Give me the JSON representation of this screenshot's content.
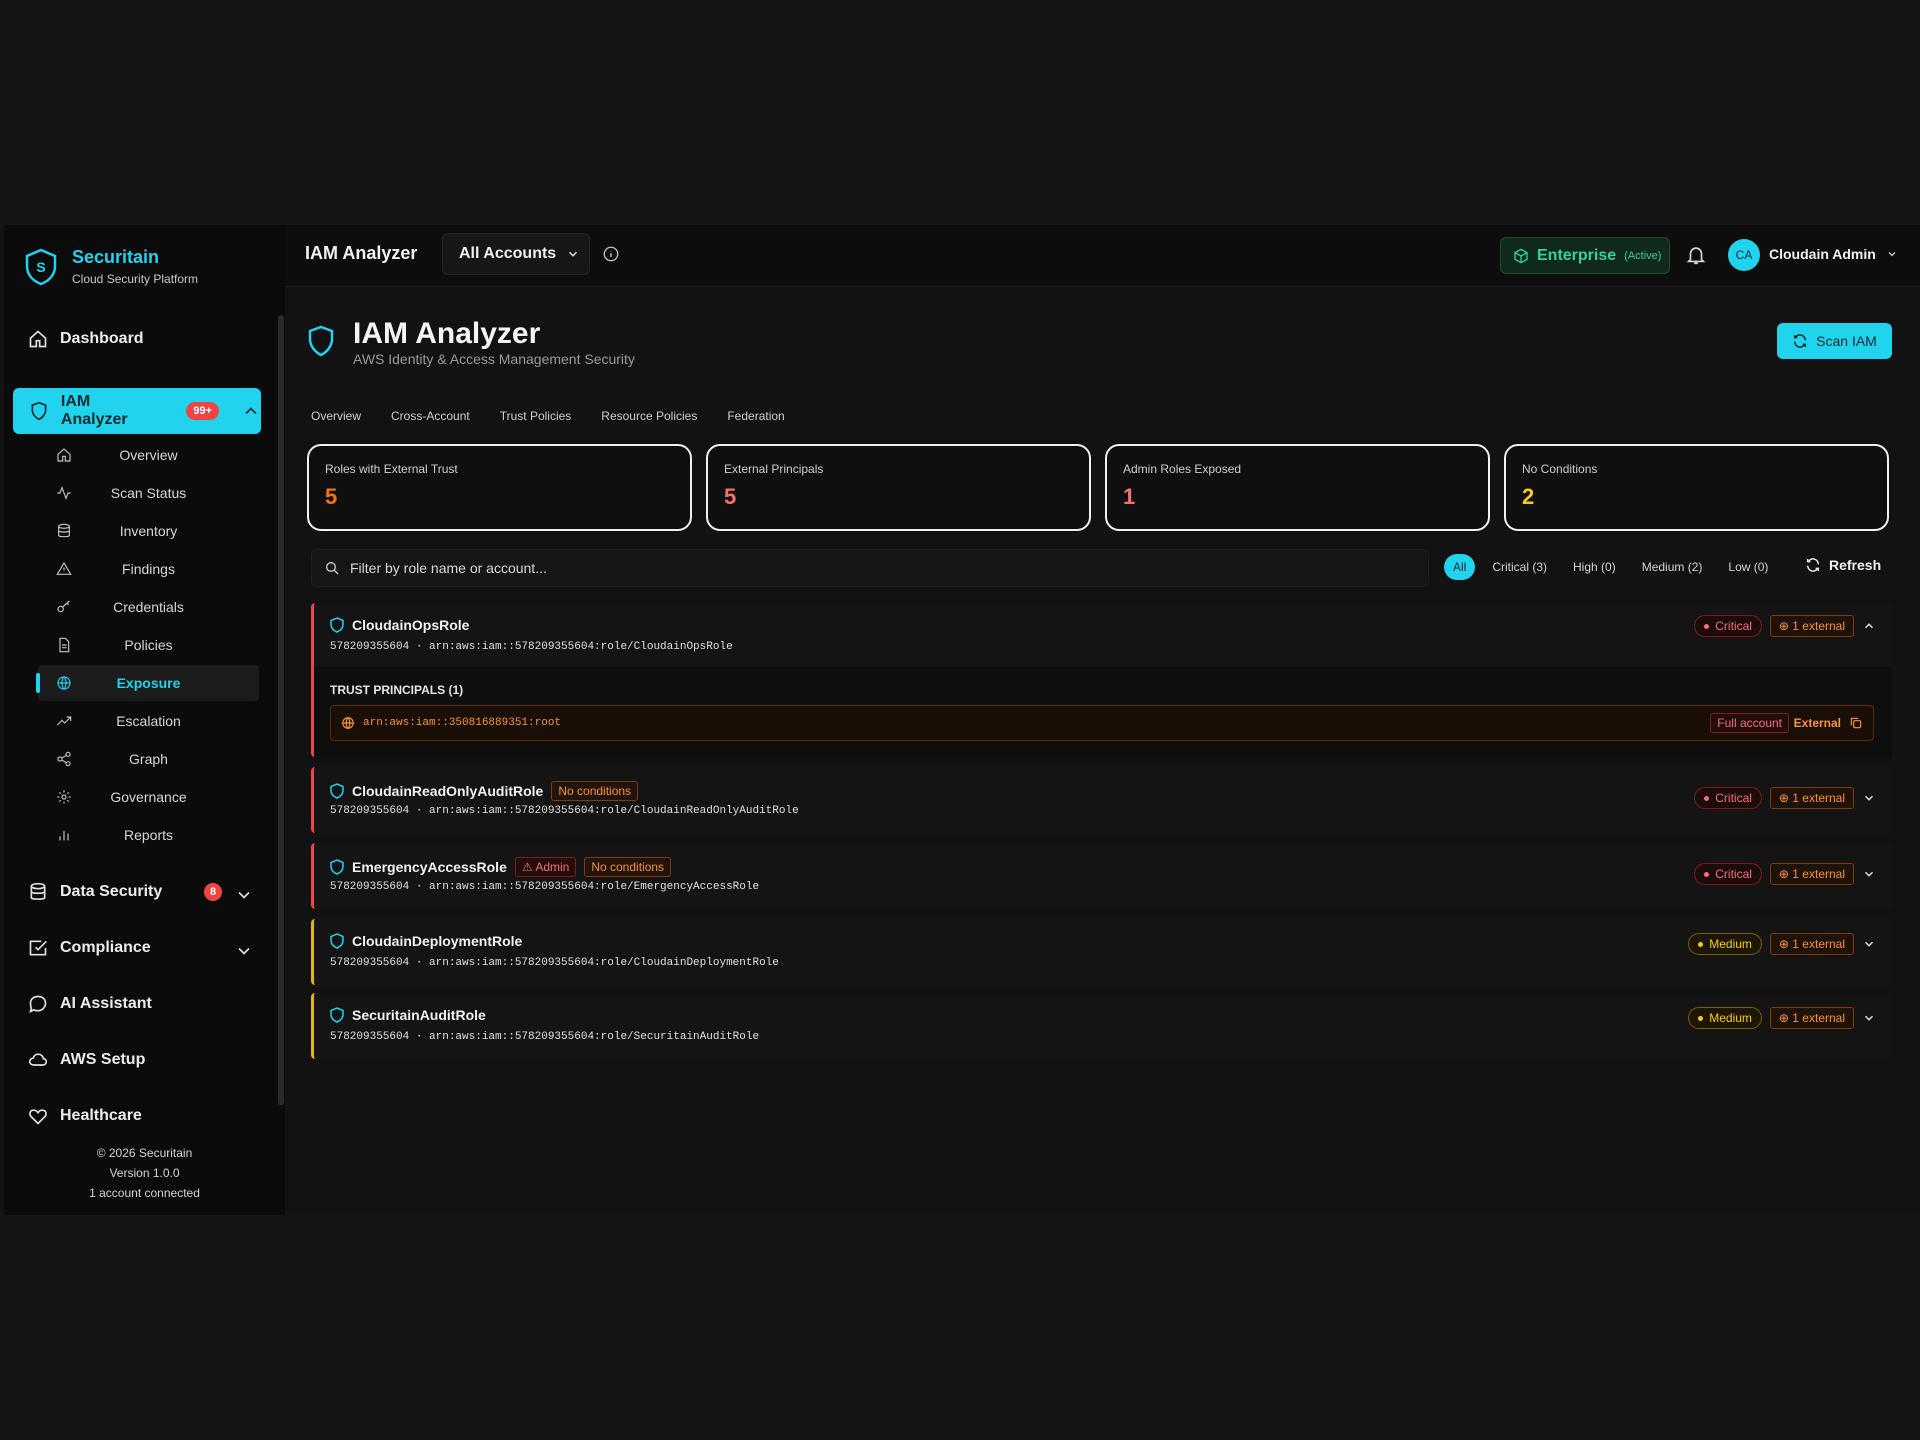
{
  "brand": {
    "name": "Securitain",
    "subtitle": "Cloud Security Platform"
  },
  "sidebar": {
    "dashboard": "Dashboard",
    "iam": {
      "label": "IAM Analyzer",
      "badge": "99+"
    },
    "sub_items": [
      {
        "label": "Overview",
        "icon": "home-icon"
      },
      {
        "label": "Scan Status",
        "icon": "activity-icon"
      },
      {
        "label": "Inventory",
        "icon": "database-icon"
      },
      {
        "label": "Findings",
        "icon": "warning-icon"
      },
      {
        "label": "Credentials",
        "icon": "key-icon"
      },
      {
        "label": "Policies",
        "icon": "document-icon"
      },
      {
        "label": "Exposure",
        "icon": "globe-icon",
        "active": true
      },
      {
        "label": "Escalation",
        "icon": "trending-up-icon"
      },
      {
        "label": "Graph",
        "icon": "share-icon"
      },
      {
        "label": "Governance",
        "icon": "gear-icon"
      },
      {
        "label": "Reports",
        "icon": "bar-chart-icon"
      }
    ],
    "data_security": {
      "label": "Data Security",
      "badge": "8"
    },
    "compliance": "Compliance",
    "ai_assistant": "AI Assistant",
    "aws_setup": "AWS Setup",
    "healthcare": "Healthcare",
    "footer": {
      "copyright": "© 2026 Securitain",
      "version": "Version 1.0.0",
      "accounts": "1 account connected"
    }
  },
  "topbar": {
    "title": "IAM Analyzer",
    "account_select": "All Accounts",
    "plan": "Enterprise",
    "plan_status": "(Active)",
    "avatar": "CA",
    "user": "Cloudain Admin"
  },
  "page": {
    "title": "IAM Analyzer",
    "subtitle": "AWS Identity & Access Management Security",
    "scan_button": "Scan IAM",
    "tabs": [
      "Overview",
      "Cross-Account",
      "Trust Policies",
      "Resource Policies",
      "Federation"
    ]
  },
  "kpis": [
    {
      "label": "Roles with External Trust",
      "value": "5",
      "color": "#f97316"
    },
    {
      "label": "External Principals",
      "value": "5",
      "color": "#f87171"
    },
    {
      "label": "Admin Roles Exposed",
      "value": "1",
      "color": "#f87171"
    },
    {
      "label": "No Conditions",
      "value": "2",
      "color": "#facc15"
    }
  ],
  "search": {
    "placeholder": "Filter by role name or account..."
  },
  "filters": [
    "All",
    "Critical (3)",
    "High (0)",
    "Medium (2)",
    "Low (0)"
  ],
  "refresh": "Refresh",
  "roles": [
    {
      "name": "CloudainOpsRole",
      "arn": "578209355604 · arn:aws:iam::578209355604:role/CloudainOpsRole",
      "severity": "Critical",
      "external": "1 external"
    },
    {
      "name": "CloudainReadOnlyAuditRole",
      "tag": "No conditions",
      "arn": "578209355604 · arn:aws:iam::578209355604:role/CloudainReadOnlyAuditRole",
      "severity": "Critical",
      "external": "1 external"
    },
    {
      "name": "EmergencyAccessRole",
      "admin": "Admin",
      "tag": "No conditions",
      "arn": "578209355604 · arn:aws:iam::578209355604:role/EmergencyAccessRole",
      "severity": "Critical",
      "external": "1 external"
    },
    {
      "name": "CloudainDeploymentRole",
      "arn": "578209355604 · arn:aws:iam::578209355604:role/CloudainDeploymentRole",
      "severity": "Medium",
      "external": "1 external"
    },
    {
      "name": "SecuritainAuditRole",
      "arn": "578209355604 · arn:aws:iam::578209355604:role/SecuritainAuditRole",
      "severity": "Medium",
      "external": "1 external"
    }
  ],
  "trust": {
    "heading": "TRUST PRINCIPALS (1)",
    "principal": "arn:aws:iam::350816889351:root",
    "scope": "Full account",
    "type": "External"
  },
  "colors": {
    "accent": "#22d3ee",
    "critical": "#ef4444",
    "medium": "#eab308",
    "external": "#fb923c"
  }
}
